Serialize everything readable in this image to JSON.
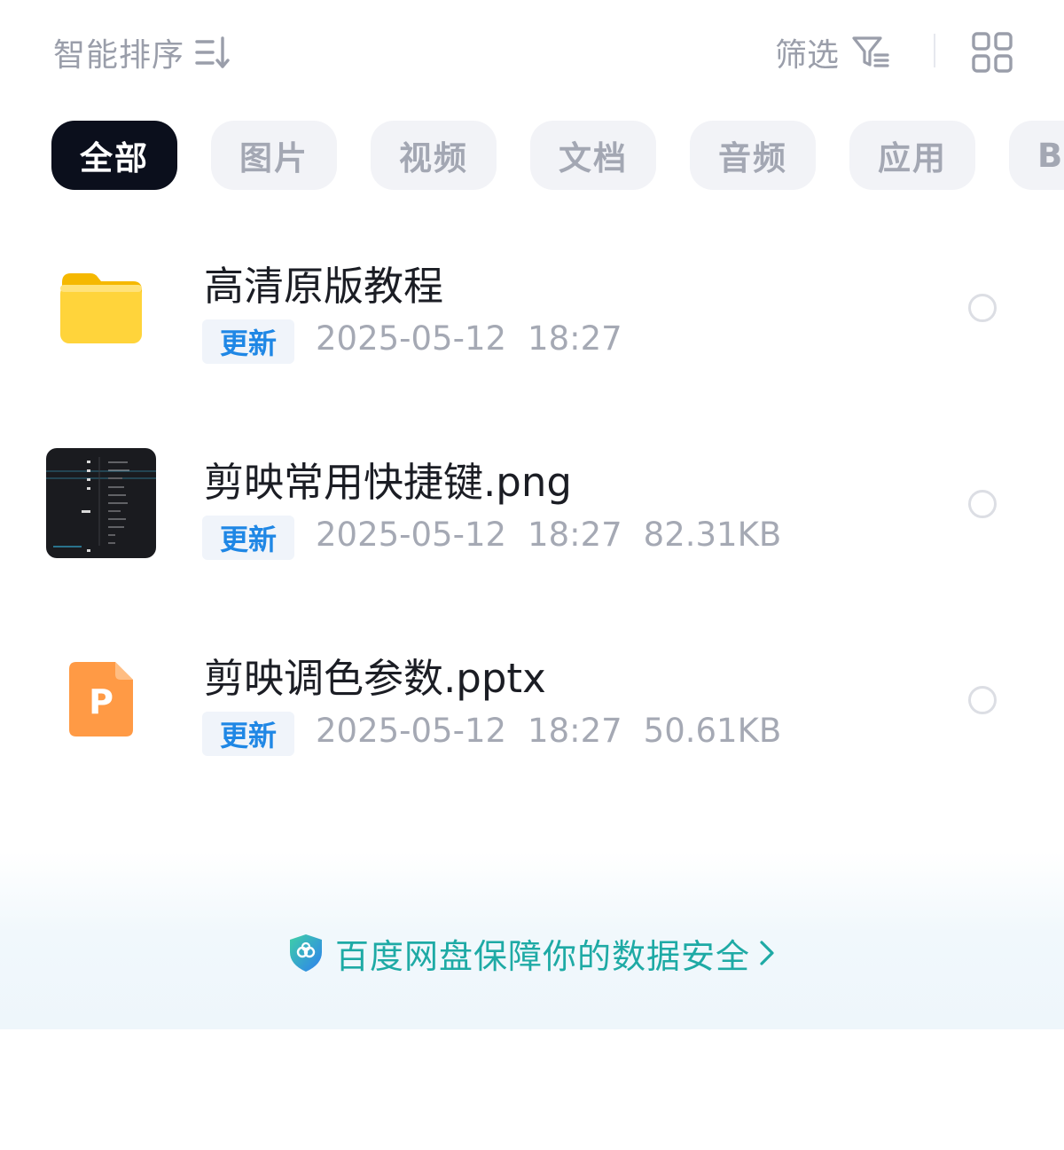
{
  "toolbar": {
    "sort_label": "智能排序",
    "filter_label": "筛选"
  },
  "categories": [
    {
      "label": "全部",
      "active": true
    },
    {
      "label": "图片",
      "active": false
    },
    {
      "label": "视频",
      "active": false
    },
    {
      "label": "文档",
      "active": false
    },
    {
      "label": "音频",
      "active": false
    },
    {
      "label": "应用",
      "active": false
    },
    {
      "label": "BT",
      "active": false
    }
  ],
  "files": [
    {
      "name": "高清原版教程",
      "type": "folder-icon",
      "badge": "更新",
      "date": "2025-05-12",
      "time": "18:27",
      "size": ""
    },
    {
      "name": "剪映常用快捷键.png",
      "type": "image-thumbnail",
      "badge": "更新",
      "date": "2025-05-12",
      "time": "18:27",
      "size": "82.31KB"
    },
    {
      "name": "剪映调色参数.pptx",
      "type": "pptx-icon",
      "icon_letter": "P",
      "badge": "更新",
      "date": "2025-05-12",
      "time": "18:27",
      "size": "50.61KB"
    }
  ],
  "footer": {
    "security_text": "百度网盘保障你的数据安全"
  },
  "colors": {
    "active_chip_bg": "#0b0f1c",
    "badge_text": "#1f87e5",
    "security_text": "#1eaaa5",
    "folder_yellow": "#ffd43b",
    "pptx_orange": "#ff9a45"
  }
}
